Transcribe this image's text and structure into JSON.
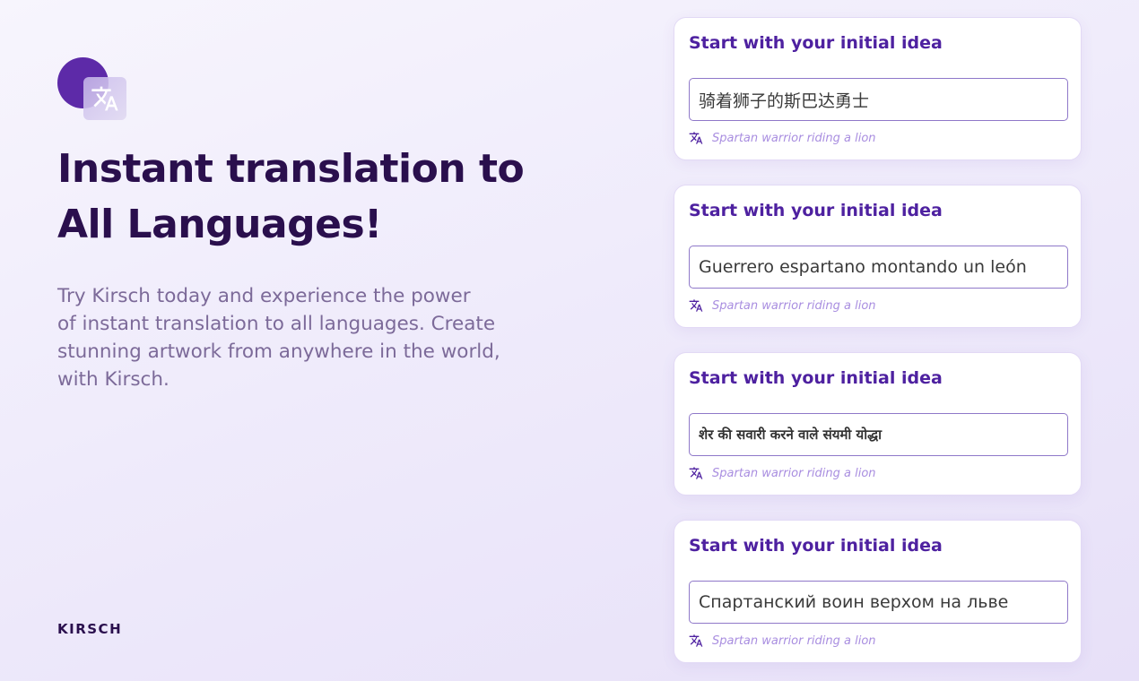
{
  "hero": {
    "icon": "translate-icon",
    "headline_line1": "Instant translation to",
    "headline_line2": "All Languages!",
    "subtext_line1": "Try Kirsch today and experience the power",
    "subtext_line2": "of instant translation to all languages. Create",
    "subtext_line3": "stunning artwork from anywhere in the world,",
    "subtext_line4": "with Kirsch."
  },
  "brand": {
    "name": "KIRSCH"
  },
  "colors": {
    "accent": "#5d2aa8",
    "title": "#2a0f4d",
    "card_title": "#4e21a0",
    "translation_text": "#a98ee0"
  },
  "cards": [
    {
      "title": "Start with your initial idea",
      "input_value": "骑着狮子的斯巴达勇士",
      "translation": "Spartan warrior riding a lion"
    },
    {
      "title": "Start with your initial idea",
      "input_value": "Guerrero espartano montando un león",
      "translation": "Spartan warrior riding a lion"
    },
    {
      "title": "Start with your initial idea",
      "input_value": "शेर की सवारी करने वाले संयमी योद्धा",
      "translation": "Spartan warrior riding a lion"
    },
    {
      "title": "Start with your initial idea",
      "input_value": "Спартанский воин верхом на льве",
      "translation": "Spartan warrior riding a lion"
    }
  ]
}
